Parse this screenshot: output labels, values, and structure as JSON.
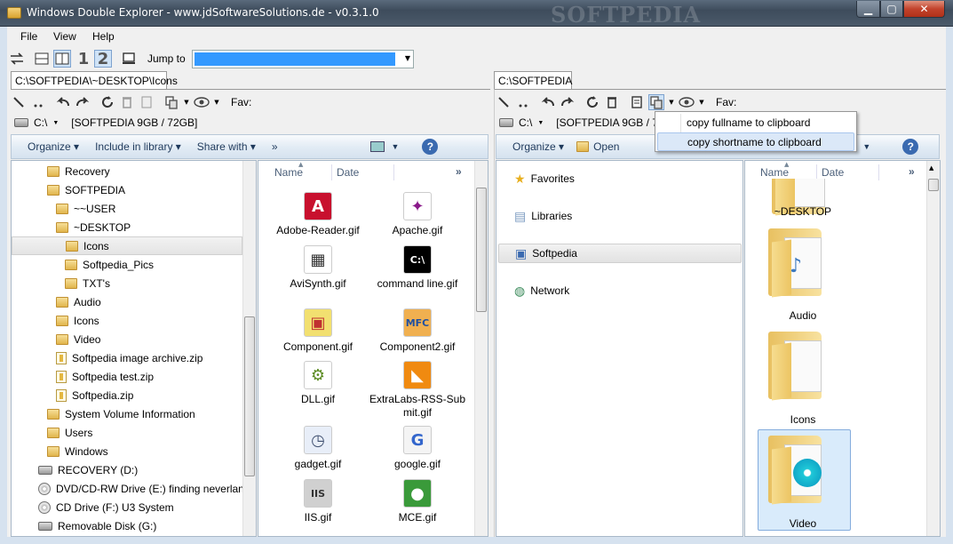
{
  "window": {
    "title": "Windows Double Explorer - www.jdSoftwareSolutions.de - v0.3.1.0",
    "watermark": "SOFTPEDIA"
  },
  "menu": [
    "File",
    "View",
    "Help"
  ],
  "toolbar": {
    "layout_1": "1",
    "layout_2": "2",
    "jump_label": "Jump to",
    "jump_value": ""
  },
  "left": {
    "tab": "C:\\SOFTPEDIA\\~DESKTOP\\Icons",
    "fav_label": "Fav:",
    "drive": "C:\\",
    "drive_info": "[SOFTPEDIA  9GB / 72GB]",
    "cmd": {
      "organize": "Organize",
      "include": "Include in library",
      "share": "Share with",
      "more": "»"
    },
    "tree": [
      {
        "label": "Recovery",
        "indent": 1,
        "icon": "folder-icon"
      },
      {
        "label": "SOFTPEDIA",
        "indent": 1,
        "icon": "folder-icon"
      },
      {
        "label": "~~USER",
        "indent": 2,
        "icon": "folder-icon"
      },
      {
        "label": "~DESKTOP",
        "indent": 2,
        "icon": "folder-icon"
      },
      {
        "label": "Icons",
        "indent": 3,
        "icon": "folder-icon",
        "selected": true
      },
      {
        "label": "Softpedia_Pics",
        "indent": 3,
        "icon": "folder-icon"
      },
      {
        "label": "TXT's",
        "indent": 3,
        "icon": "folder-icon"
      },
      {
        "label": "Audio",
        "indent": 2,
        "icon": "folder-icon"
      },
      {
        "label": "Icons",
        "indent": 2,
        "icon": "folder-icon"
      },
      {
        "label": "Video",
        "indent": 2,
        "icon": "folder-icon"
      },
      {
        "label": "Softpedia image archive.zip",
        "indent": 2,
        "icon": "zip-icon"
      },
      {
        "label": "Softpedia test.zip",
        "indent": 2,
        "icon": "zip-icon"
      },
      {
        "label": "Softpedia.zip",
        "indent": 2,
        "icon": "zip-icon"
      },
      {
        "label": "System Volume Information",
        "indent": 1,
        "icon": "folder-icon"
      },
      {
        "label": "Users",
        "indent": 1,
        "icon": "folder-icon"
      },
      {
        "label": "Windows",
        "indent": 1,
        "icon": "folder-icon"
      },
      {
        "label": "RECOVERY (D:)",
        "indent": 0,
        "icon": "drive-icon"
      },
      {
        "label": "DVD/CD-RW Drive (E:) finding neverland",
        "indent": 0,
        "icon": "cd-icon"
      },
      {
        "label": "CD Drive (F:) U3 System",
        "indent": 0,
        "icon": "cd-icon"
      },
      {
        "label": "Removable Disk (G:)",
        "indent": 0,
        "icon": "drive-icon"
      }
    ],
    "col_name": "Name",
    "col_date": "Date",
    "col_more": "»",
    "files": [
      {
        "label": "Adobe-Reader.gif",
        "glyph": "A",
        "bg": "#c8102e",
        "fg": "#fff"
      },
      {
        "label": "Apache.gif",
        "glyph": "✦",
        "bg": "#fff",
        "fg": "#8a1a8a"
      },
      {
        "label": "AviSynth.gif",
        "glyph": "▦",
        "bg": "#fff",
        "fg": "#333"
      },
      {
        "label": "command line.gif",
        "glyph": "C:\\",
        "bg": "#000",
        "fg": "#fff"
      },
      {
        "label": "Component.gif",
        "glyph": "▣",
        "bg": "#f2e070",
        "fg": "#c03030"
      },
      {
        "label": "Component2.gif",
        "glyph": "MFC",
        "bg": "#f0b050",
        "fg": "#2050a0"
      },
      {
        "label": "DLL.gif",
        "glyph": "⚙",
        "bg": "#fff",
        "fg": "#5a8a20"
      },
      {
        "label": "ExtraLabs-RSS-Submit.gif",
        "glyph": "◣",
        "bg": "#f08a10",
        "fg": "#fff"
      },
      {
        "label": "gadget.gif",
        "glyph": "◷",
        "bg": "#e8eef8",
        "fg": "#405070"
      },
      {
        "label": "google.gif",
        "glyph": "G",
        "bg": "#f4f4f4",
        "fg": "#3366cc"
      },
      {
        "label": "IIS.gif",
        "glyph": "IIS",
        "bg": "#d0d0d0",
        "fg": "#333"
      },
      {
        "label": "MCE.gif",
        "glyph": "●",
        "bg": "#3a9a3a",
        "fg": "#fff"
      }
    ]
  },
  "right": {
    "tab": "C:\\SOFTPEDIA",
    "fav_label": "Fav:",
    "drive": "C:\\",
    "drive_info": "[SOFTPEDIA  9GB / 72G",
    "cmd": {
      "organize": "Organize",
      "open": "Open"
    },
    "context_menu": [
      "copy fullname to clipboard",
      "copy shortname to clipboard"
    ],
    "nav": [
      {
        "label": "Favorites",
        "icon": "star-icon"
      },
      {
        "label": "Libraries",
        "icon": "library-icon"
      },
      {
        "label": "Softpedia",
        "icon": "computer-icon",
        "selected": true
      },
      {
        "label": "Network",
        "icon": "network-icon"
      }
    ],
    "col_name": "Name",
    "col_date": "Date",
    "col_more": "»",
    "folders": [
      "~DESKTOP",
      "Audio",
      "Icons",
      "Video"
    ]
  },
  "colors": {
    "accent": "#3399ff",
    "selection": "#cce8ff",
    "menu_highlight": "#dbe8f8"
  }
}
